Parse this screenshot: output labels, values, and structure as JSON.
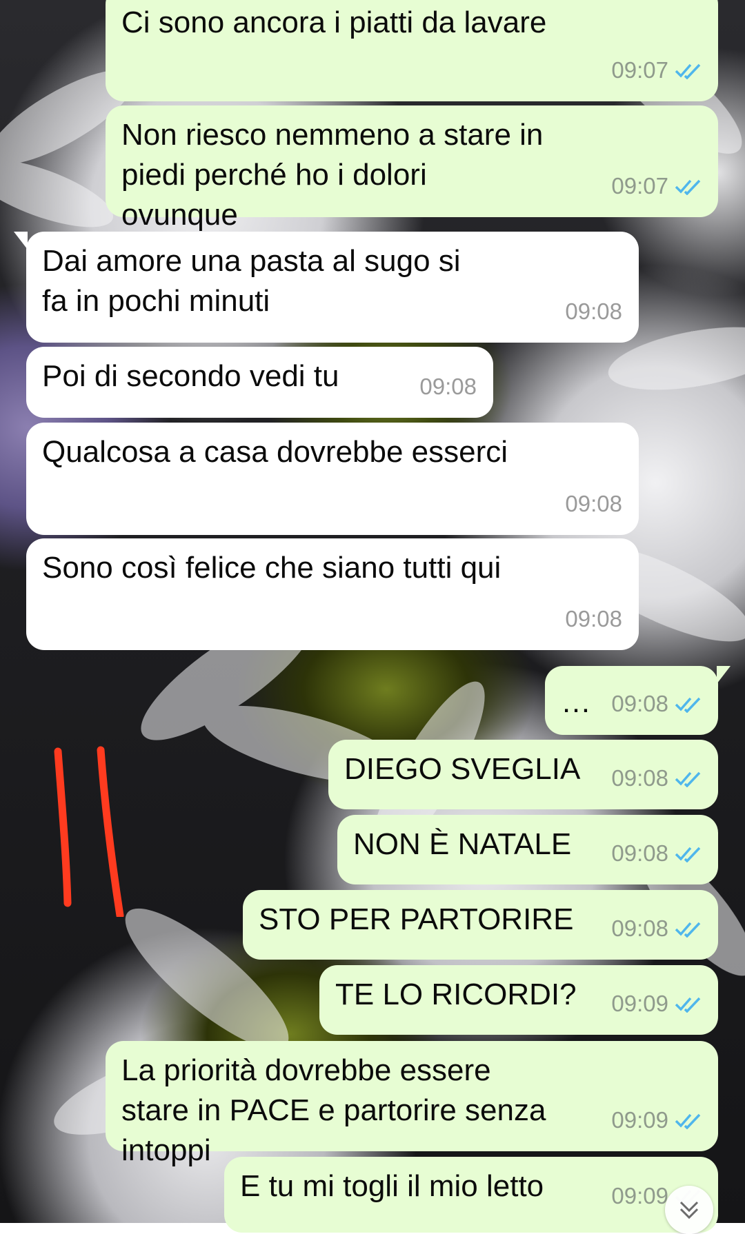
{
  "colors": {
    "outgoing_bubble": "#e7fdd3",
    "incoming_bubble": "#ffffff",
    "read_ticks": "#4fb6ec",
    "annotation": "#ff3b1f"
  },
  "messages": [
    {
      "direction": "out",
      "text": "Ci sono ancora i piatti da lavare",
      "time": "09:07",
      "status": "read"
    },
    {
      "direction": "out",
      "text": "Non riesco nemmeno a stare in piedi perché ho i dolori ovunque",
      "time": "09:07",
      "status": "read"
    },
    {
      "direction": "in",
      "text": "Dai amore una pasta al sugo si fa in pochi minuti",
      "time": "09:08"
    },
    {
      "direction": "in",
      "text": "Poi di secondo vedi tu",
      "time": "09:08"
    },
    {
      "direction": "in",
      "text": "Qualcosa a casa dovrebbe esserci",
      "time": "09:08"
    },
    {
      "direction": "in",
      "text": "Sono così felice che siano tutti qui",
      "time": "09:08"
    },
    {
      "direction": "out",
      "text": "…",
      "time": "09:08",
      "status": "read"
    },
    {
      "direction": "out",
      "text": "DIEGO SVEGLIA",
      "time": "09:08",
      "status": "read"
    },
    {
      "direction": "out",
      "text": "NON È NATALE",
      "time": "09:08",
      "status": "read"
    },
    {
      "direction": "out",
      "text": "STO PER PARTORIRE",
      "time": "09:08",
      "status": "read"
    },
    {
      "direction": "out",
      "text": "TE LO RICORDI?",
      "time": "09:09",
      "status": "read"
    },
    {
      "direction": "out",
      "text": "La priorità dovrebbe essere stare in PACE e partorire senza intoppi",
      "time": "09:09",
      "status": "read"
    },
    {
      "direction": "out",
      "text": "E tu mi togli il mio letto",
      "time": "09:09",
      "status": "read"
    }
  ],
  "icons": {
    "read_receipt": "double-check-icon",
    "scroll_down": "chevron-down-icon"
  }
}
